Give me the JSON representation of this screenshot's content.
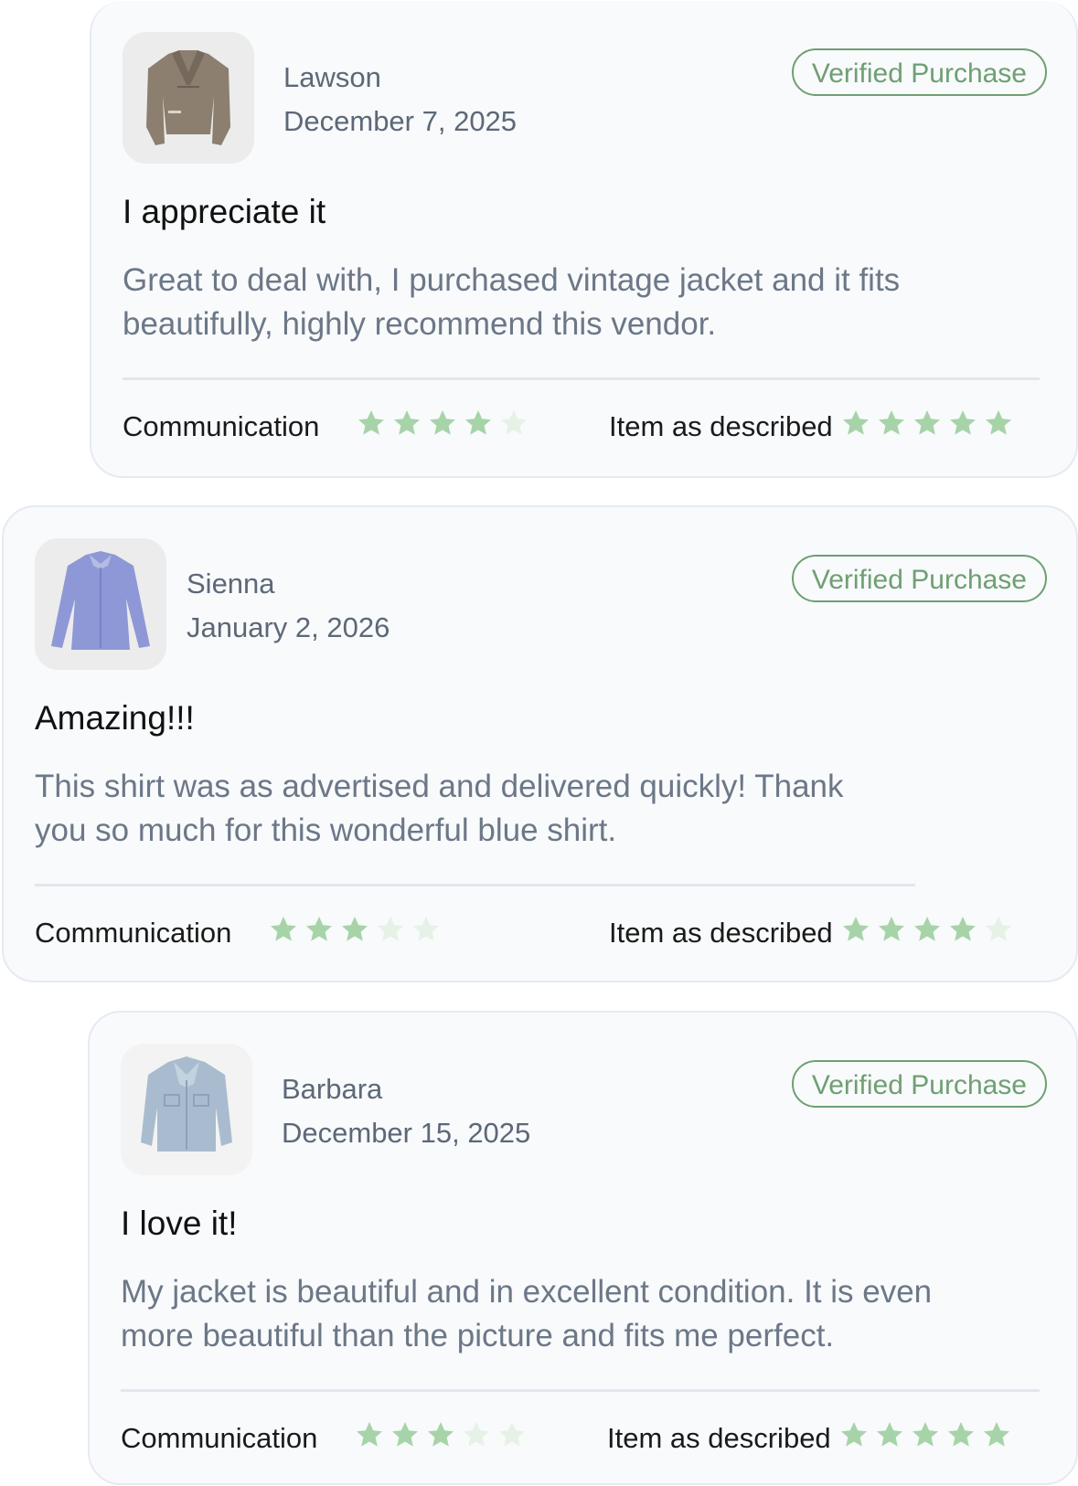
{
  "reviews": [
    {
      "reviewer": "Lawson",
      "date": "December 7, 2025",
      "badge": "Verified Purchase",
      "title": "I appreciate it",
      "body": "Great to deal with, I purchased vintage jacket and it fits beautifully, highly recommend this vendor.",
      "thumbnail": "tan-moto-jacket",
      "ratings": [
        {
          "label": "Communication",
          "stars": 4,
          "max": 5
        },
        {
          "label": "Item as described",
          "stars": 5,
          "max": 5
        }
      ]
    },
    {
      "reviewer": "Sienna",
      "date": "January 2, 2026",
      "badge": "Verified Purchase",
      "title": "Amazing!!!",
      "body": "This shirt was as advertised and delivered quickly! Thank you so much for this wonderful blue shirt.",
      "thumbnail": "blue-shirt",
      "ratings": [
        {
          "label": "Communication",
          "stars": 3,
          "max": 5
        },
        {
          "label": "Item as described",
          "stars": 4,
          "max": 5
        }
      ]
    },
    {
      "reviewer": "Barbara",
      "date": "December 15, 2025",
      "badge": "Verified Purchase",
      "title": "I love it!",
      "body": "My jacket is beautiful and in excellent condition. It is even more beautiful than the picture and fits me perfect.",
      "thumbnail": "denim-jacket",
      "ratings": [
        {
          "label": "Communication",
          "stars": 3,
          "max": 5
        },
        {
          "label": "Item as described",
          "stars": 5,
          "max": 5
        }
      ]
    }
  ],
  "colors": {
    "badge": "#6f9f72",
    "star_filled": "#a7d3a8",
    "star_empty": "#e6f2e6",
    "body_text": "#6c7787"
  }
}
